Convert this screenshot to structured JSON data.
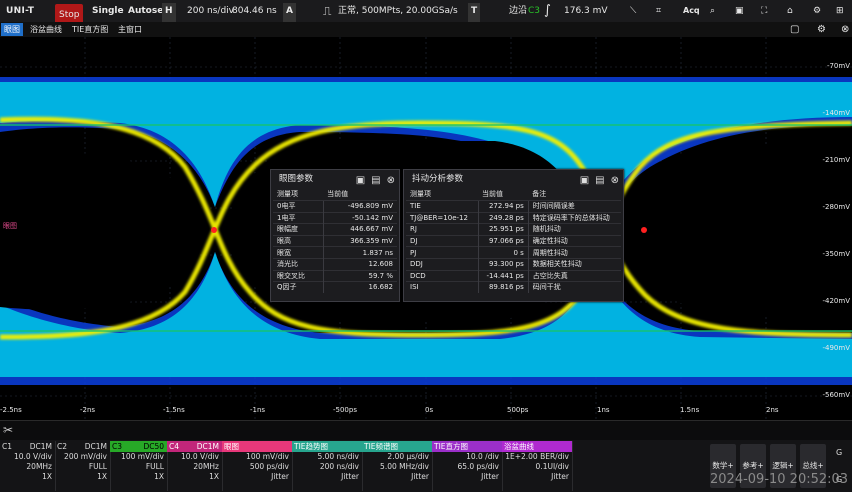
{
  "topbar": {
    "logo": "UNI-T",
    "run_state": "Stop",
    "single": "Single",
    "autoset": "Autoset",
    "h_label": "H",
    "timebase": "200 ns/div",
    "h_offset": "804.46 ns",
    "a_label": "A",
    "acq_info": "正常, 500MPts, 20.00GSa/s",
    "t_label": "T",
    "trig_type": "边沿",
    "trig_src": "C3",
    "trig_level": "176.3 mV",
    "acq_btn": "Acq"
  },
  "tabs": [
    "眼图",
    "浴盆曲线",
    "TIE直方图",
    "主窗口"
  ],
  "scope": {
    "ch_marker": "眼图",
    "voltage_labels": [
      "-70mV",
      "-140mV",
      "-210mV",
      "-280mV",
      "-350mV",
      "-420mV",
      "-490mV",
      "-560mV"
    ],
    "time_labels": [
      "-2.5ns",
      "-2ns",
      "-1.5ns",
      "-1ns",
      "-500ps",
      "0s",
      "500ps",
      "1ns",
      "1.5ns",
      "2ns"
    ]
  },
  "eye_panel": {
    "title": "眼图参数",
    "col1": "测量项",
    "col2": "当前值",
    "rows": [
      {
        "name": "0电平",
        "value": "-496.809 mV"
      },
      {
        "name": "1电平",
        "value": "-50.142 mV"
      },
      {
        "name": "眼幅度",
        "value": "446.667 mV"
      },
      {
        "name": "眼高",
        "value": "366.359 mV"
      },
      {
        "name": "眼宽",
        "value": "1.837 ns"
      },
      {
        "name": "消光比",
        "value": "12.608"
      },
      {
        "name": "眼交叉比",
        "value": "59.7 %"
      },
      {
        "name": "Q因子",
        "value": "16.682"
      }
    ]
  },
  "jitter_panel": {
    "title": "抖动分析参数",
    "col1": "测量项",
    "col2": "当前值",
    "col3": "备注",
    "rows": [
      {
        "name": "TIE",
        "value": "272.94 ps",
        "note": "时间间隔误差"
      },
      {
        "name": "TJ@BER=10e-12",
        "value": "249.28 ps",
        "note": "特定误码率下的总体抖动"
      },
      {
        "name": "RJ",
        "value": "25.951 ps",
        "note": "随机抖动"
      },
      {
        "name": "DJ",
        "value": "97.066 ps",
        "note": "确定性抖动"
      },
      {
        "name": "PJ",
        "value": "0 s",
        "note": "周期性抖动"
      },
      {
        "name": "DDJ",
        "value": "93.300 ps",
        "note": "数据相关性抖动"
      },
      {
        "name": "DCD",
        "value": "-14.441 ps",
        "note": "占空比失真"
      },
      {
        "name": "ISI",
        "value": "89.816 ps",
        "note": "码间干扰"
      }
    ]
  },
  "channels": [
    {
      "name": "C1",
      "coupling": "DC1M",
      "r1": "10.0 V/div",
      "r2": "20MHz",
      "r3": "1X",
      "color": "#e0e0e0"
    },
    {
      "name": "C2",
      "coupling": "DC1M",
      "r1": "200 mV/div",
      "r2": "FULL",
      "r3": "1X",
      "color": "#e0e0e0"
    },
    {
      "name": "C3",
      "coupling": "DC50",
      "r1": "100 mV/div",
      "r2": "FULL",
      "r3": "1X",
      "color": "#28c028"
    },
    {
      "name": "C4",
      "coupling": "DC1M",
      "r1": "10.0 V/div",
      "r2": "20MHz",
      "r3": "1X",
      "color": "#e0308f"
    },
    {
      "name": "眼图",
      "coupling": "",
      "r1": "100 mV/div",
      "r2": "500 ps/div",
      "r3": "Jitter",
      "color": "#e8387a"
    },
    {
      "name": "TIE趋势图",
      "coupling": "",
      "r1": "5.00 ns/div",
      "r2": "200 ns/div",
      "r3": "Jitter",
      "color": "#27a58e"
    },
    {
      "name": "TIE频谱图",
      "coupling": "",
      "r1": "2.00 μs/div",
      "r2": "5.00 MHz/div",
      "r3": "Jitter",
      "color": "#27a58e"
    },
    {
      "name": "TIE直方图",
      "coupling": "",
      "r1": "10.0 /div",
      "r2": "65.0 ps/div",
      "r3": "Jitter",
      "color": "#9b2fc9"
    },
    {
      "name": "浴盆曲线",
      "coupling": "",
      "r1": "1E+2.00 BER/div",
      "r2": "0.1UI/div",
      "r3": "Jitter",
      "color": "#b02ad0"
    }
  ],
  "right_buttons": [
    "数学+",
    "参考+",
    "逻辑+",
    "总线+"
  ],
  "gen_labels": [
    "G",
    "G"
  ],
  "clock": "2024-09-10 20:52:03"
}
